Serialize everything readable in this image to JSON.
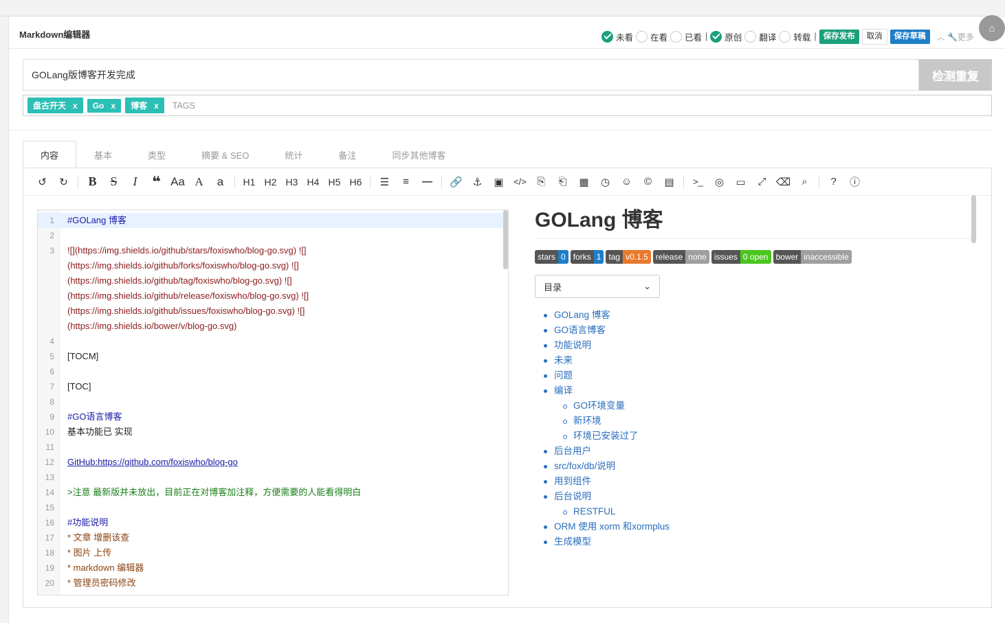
{
  "header": {
    "title": "Markdown编辑器",
    "status_options": [
      {
        "label": "未看",
        "checked": true
      },
      {
        "label": "在看",
        "checked": false
      },
      {
        "label": "已看",
        "checked": false
      }
    ],
    "type_options": [
      {
        "label": "原创",
        "checked": true
      },
      {
        "label": "翻译",
        "checked": false
      },
      {
        "label": "转载",
        "checked": false
      }
    ],
    "publish_label": "保存发布",
    "cancel_label": "取消",
    "draft_label": "保存草稿",
    "more_label": "更多"
  },
  "form": {
    "title_value": "GOLang版博客开发完成",
    "check_dup_label": "检测重复",
    "tags": [
      "盘古开天",
      "Go",
      "博客"
    ],
    "tags_placeholder": "TAGS"
  },
  "tabs": [
    "内容",
    "基本",
    "类型",
    "摘要 & SEO",
    "统计",
    "备注",
    "同步其他博客"
  ],
  "toolbar": {
    "headings": [
      "H1",
      "H2",
      "H3",
      "H4",
      "H5",
      "H6"
    ]
  },
  "editor": {
    "lines": [
      {
        "n": "1",
        "t": "#GOLang 博客",
        "c": "c-head"
      },
      {
        "n": "2",
        "t": "",
        "c": "c-plain"
      },
      {
        "n": "3",
        "t": "![](https://img.shields.io/github/stars/foxiswho/blog-go.svg) ![]",
        "c": "c-link"
      },
      {
        "n": "",
        "t": "(https://img.shields.io/github/forks/foxiswho/blog-go.svg) ![]",
        "c": "c-link"
      },
      {
        "n": "",
        "t": "(https://img.shields.io/github/tag/foxiswho/blog-go.svg) ![]",
        "c": "c-link"
      },
      {
        "n": "",
        "t": "(https://img.shields.io/github/release/foxiswho/blog-go.svg) ![]",
        "c": "c-link"
      },
      {
        "n": "",
        "t": "(https://img.shields.io/github/issues/foxiswho/blog-go.svg) ![]",
        "c": "c-link"
      },
      {
        "n": "",
        "t": "(https://img.shields.io/bower/v/blog-go.svg)",
        "c": "c-link"
      },
      {
        "n": "4",
        "t": "",
        "c": "c-plain"
      },
      {
        "n": "5",
        "t": "[TOCM]",
        "c": "c-plain"
      },
      {
        "n": "6",
        "t": "",
        "c": "c-plain"
      },
      {
        "n": "7",
        "t": "[TOC]",
        "c": "c-plain"
      },
      {
        "n": "8",
        "t": "",
        "c": "c-plain"
      },
      {
        "n": "9",
        "t": "#GO语言博客",
        "c": "c-head"
      },
      {
        "n": "10",
        "t": "基本功能已 实现",
        "c": "c-plain"
      },
      {
        "n": "11",
        "t": "",
        "c": "c-plain"
      },
      {
        "n": "12",
        "t": "GitHub:https://github.com/foxiswho/blog-go",
        "c": "c-url"
      },
      {
        "n": "13",
        "t": "",
        "c": "c-plain"
      },
      {
        "n": "14",
        "t": ">注意 最新版并未放出，目前正在对博客加注释，方便需要的人能看得明白",
        "c": "c-quote"
      },
      {
        "n": "15",
        "t": "",
        "c": "c-plain"
      },
      {
        "n": "16",
        "t": "#功能说明",
        "c": "c-head"
      },
      {
        "n": "17",
        "t": " * 文章 增删该查",
        "c": "c-list"
      },
      {
        "n": "18",
        "t": " * 图片 上传",
        "c": "c-list"
      },
      {
        "n": "19",
        "t": " * markdown 编辑器",
        "c": "c-list"
      },
      {
        "n": "20",
        "t": " * 管理员密码修改",
        "c": "c-list"
      }
    ]
  },
  "preview": {
    "title": "GOLang 博客",
    "badges": [
      {
        "left": "stars",
        "right": "0",
        "color": "#1e7ec8"
      },
      {
        "left": "forks",
        "right": "1",
        "color": "#1e7ec8"
      },
      {
        "left": "tag",
        "right": "v0.1.5",
        "color": "#e87a2e"
      },
      {
        "left": "release",
        "right": "none",
        "color": "#9f9f9f"
      },
      {
        "left": "issues",
        "right": "0 open",
        "color": "#4cc61e"
      },
      {
        "left": "bower",
        "right": "inaccessible",
        "color": "#9f9f9f"
      }
    ],
    "toc_select": "目录",
    "toc": [
      {
        "label": "GOLang 博客",
        "sub": false
      },
      {
        "label": "GO语言博客",
        "sub": false
      },
      {
        "label": "功能说明",
        "sub": false
      },
      {
        "label": "未来",
        "sub": false
      },
      {
        "label": "问题",
        "sub": false
      },
      {
        "label": "编译",
        "sub": false
      },
      {
        "label": "GO环境变量",
        "sub": true
      },
      {
        "label": "新环境",
        "sub": true
      },
      {
        "label": "环境已安装过了",
        "sub": true
      },
      {
        "label": "后台用户",
        "sub": false
      },
      {
        "label": "src/fox/db/说明",
        "sub": false
      },
      {
        "label": "用到组件",
        "sub": false
      },
      {
        "label": "后台说明",
        "sub": false
      },
      {
        "label": "RESTFUL",
        "sub": true
      },
      {
        "label": "ORM 使用 xorm 和xormplus",
        "sub": false
      },
      {
        "label": "生成模型",
        "sub": false
      }
    ]
  }
}
